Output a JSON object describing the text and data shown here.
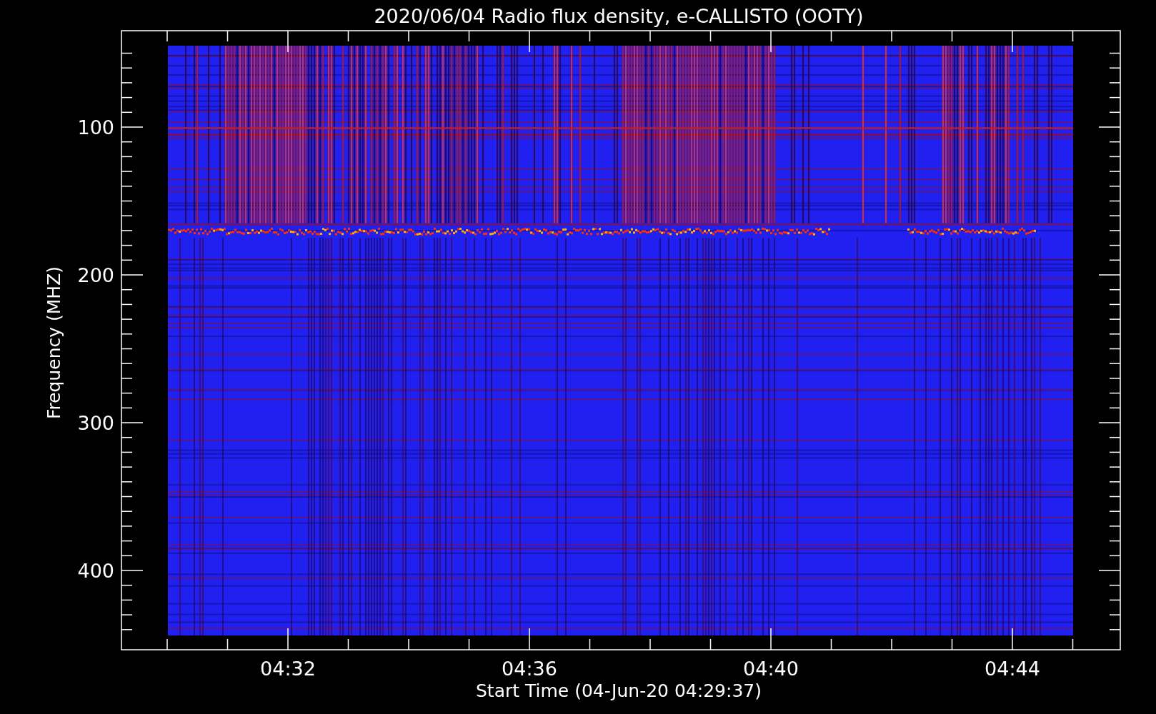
{
  "title": "2020/06/04  Radio flux density, e-CALLISTO (OOTY)",
  "y_axis": {
    "label": "Frequency (MHZ)",
    "ticks": [
      "100",
      "200",
      "300",
      "400"
    ]
  },
  "x_axis": {
    "label": "Start Time (04-Jun-20 04:29:37)",
    "ticks": [
      "04:32",
      "04:36",
      "04:40",
      "04:44"
    ]
  }
}
